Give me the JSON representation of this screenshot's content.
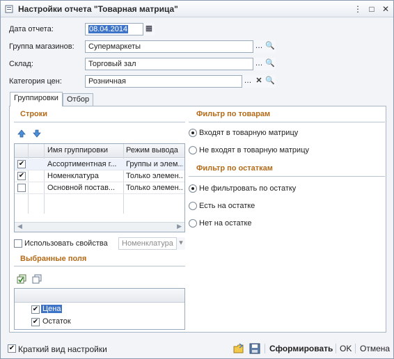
{
  "window": {
    "title": "Настройки отчета  \"Товарная матрица\""
  },
  "form": {
    "date_label": "Дата отчета:",
    "date_value": "08.04.2014",
    "store_group_label": "Группа магазинов:",
    "store_group_value": "Супермаркеты",
    "warehouse_label": "Склад:",
    "warehouse_value": "Торговый зал",
    "price_category_label": "Категория цен:",
    "price_category_value": "Розничная"
  },
  "tabs": [
    {
      "label": "Группировки",
      "active": true
    },
    {
      "label": "Отбор",
      "active": false
    }
  ],
  "rows_section": {
    "title": "Строки",
    "columns": [
      "Имя группировки",
      "Режим вывода"
    ],
    "rows": [
      {
        "checked": true,
        "name": "Ассортиментная г...",
        "mode": "Группы и элем..."
      },
      {
        "checked": true,
        "name": "Номенклатура",
        "mode": "Только элемен..."
      },
      {
        "checked": false,
        "name": "Основной постав...",
        "mode": "Только элемен..."
      }
    ],
    "use_properties_label": "Использовать свойства",
    "use_properties_select": "Номенклатура"
  },
  "selected_fields": {
    "title": "Выбранные поля",
    "items": [
      {
        "checked": true,
        "label": "Цена",
        "selected": true
      },
      {
        "checked": true,
        "label": "Остаток",
        "selected": false
      }
    ]
  },
  "product_filter": {
    "title": "Фильтр по товарам",
    "options": [
      {
        "label": "Входят в товарную матрицу",
        "selected": true
      },
      {
        "label": "Не входят в товарную матрицу",
        "selected": false
      }
    ]
  },
  "stock_filter": {
    "title": "Фильтр по остаткам",
    "options": [
      {
        "label": "Не фильтровать по остатку",
        "selected": true
      },
      {
        "label": "Есть на остатке",
        "selected": false
      },
      {
        "label": "Нет на остатке",
        "selected": false
      }
    ]
  },
  "footer": {
    "short_view_label": "Краткий вид настройки",
    "short_view_checked": true,
    "generate_label": "Сформировать",
    "ok_label": "OK",
    "cancel_label": "Отмена"
  },
  "colors": {
    "section_heading": "#b56a17",
    "selection": "#3d74c8"
  }
}
